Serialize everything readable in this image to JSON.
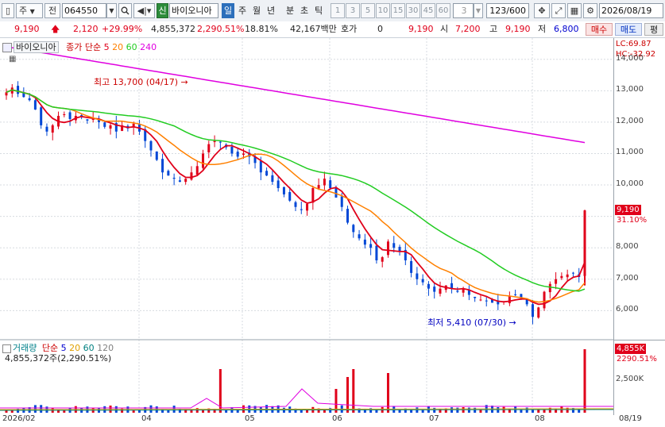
{
  "toolbar": {
    "market_type": "주",
    "market_dropdown": "전",
    "code": "064550",
    "badge_new": "신",
    "stock_name": "바이오니아",
    "period_tabs": [
      "일",
      "주",
      "월",
      "년",
      "분",
      "초",
      "틱"
    ],
    "active_period": "일",
    "minute_values": [
      "1",
      "3",
      "5",
      "10",
      "15",
      "30",
      "45",
      "60"
    ],
    "interval_value": "3",
    "count_display": "123/600",
    "date": "2026/08/19"
  },
  "quote": {
    "price": "9,190",
    "change": "2,120",
    "change_pct": "+29.99%",
    "volume": "4,855,372",
    "volume_pct": "2,290.51%",
    "turnover": "18.81%",
    "amount": "42,167백만",
    "hoga_label": "호가",
    "hoga_value": "0",
    "hoga_price": "9,190",
    "open_label": "시",
    "open": "7,200",
    "high_label": "고",
    "high": "9,190",
    "low_label": "저",
    "low": "6,800",
    "buy_button": "매수",
    "sell_button": "매도",
    "eval_button": "평"
  },
  "price_panel": {
    "stock_title": "바이오니아",
    "ma_title": "종가 단순",
    "ma_periods": [
      "5",
      "20",
      "60",
      "240"
    ],
    "ma_colors": [
      "#e0001a",
      "#ff8000",
      "#22cc22",
      "#e000e0"
    ],
    "lc": "LC:69.87",
    "hc": "HC:-32.92",
    "high_annotation": "최고 13,700 (04/17)",
    "low_annotation": "최저 5,410 (07/30)",
    "price_tag": "9,190",
    "pct_tag": "31.10%"
  },
  "volume_panel": {
    "title": "거래량",
    "ma_title": "단순",
    "ma_periods": [
      "5",
      "20",
      "60",
      "120"
    ],
    "ma_colors": [
      "#0000d0",
      "#e0a000",
      "#008080",
      "#808080"
    ],
    "summary": "4,855,372주(2,290.51%)",
    "tag_value": "4,855K",
    "tag_pct": "2290.51%",
    "axis_label": "2,500K"
  },
  "chart_data": {
    "type": "candlestick",
    "y_ticks": [
      "14,000",
      "13,000",
      "12,000",
      "11,000",
      "10,000",
      "9,000",
      "8,000",
      "7,000",
      "6,000"
    ],
    "ylim": [
      5200,
      14600
    ],
    "x_ticks": [
      "2026/02",
      "04",
      "05",
      "06",
      "07",
      "08",
      "08/19"
    ],
    "series_close": [
      12950,
      13100,
      12900,
      12800,
      12700,
      12400,
      11900,
      11700,
      11900,
      12200,
      12250,
      12100,
      12200,
      12150,
      12050,
      12100,
      12000,
      11850,
      11900,
      11700,
      11900,
      11800,
      11950,
      11700,
      11400,
      11100,
      10800,
      10400,
      10300,
      10200,
      10100,
      10200,
      10400,
      10600,
      11000,
      11300,
      11400,
      11350,
      11200,
      11000,
      10900,
      11000,
      10900,
      10700,
      10400,
      10300,
      10100,
      9900,
      9700,
      9500,
      9300,
      9200,
      9400,
      9900,
      10000,
      10200,
      9900,
      9600,
      9300,
      8800,
      8500,
      8300,
      8100,
      8000,
      7600,
      7700,
      8200,
      8000,
      7900,
      7600,
      7200,
      7000,
      6900,
      6700,
      6600,
      6700,
      6800,
      6700,
      6600,
      6700,
      6500,
      6400,
      6350,
      6300,
      6250,
      6200,
      6300,
      6450,
      6500,
      6400,
      6200,
      5800,
      6100,
      6600,
      6850,
      7000,
      7100,
      7150,
      7200,
      7070,
      9190
    ],
    "ma_values": {
      "ma240_start": 14400,
      "ma240_end": 11350
    }
  }
}
